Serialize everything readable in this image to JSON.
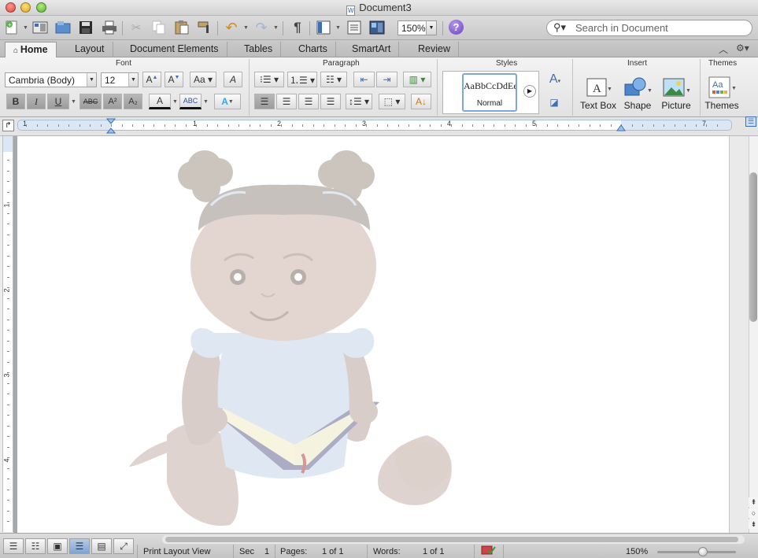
{
  "window": {
    "title": "Document3"
  },
  "toolbar": {
    "zoom": "150%",
    "search_placeholder": "Search in Document"
  },
  "tabs": [
    "Home",
    "Layout",
    "Document Elements",
    "Tables",
    "Charts",
    "SmartArt",
    "Review"
  ],
  "ribbon": {
    "group_labels": {
      "font": "Font",
      "paragraph": "Paragraph",
      "styles": "Styles",
      "insert": "Insert",
      "themes": "Themes"
    },
    "font_name": "Cambria (Body)",
    "font_size": "12",
    "style_preview": "AaBbCcDdEe",
    "style_name": "Normal",
    "insert_items": [
      "Text Box",
      "Shape",
      "Picture"
    ],
    "themes_label": "Themes",
    "font_buttons": {
      "bold": "B",
      "italic": "I",
      "underline": "U",
      "strike": "ABC",
      "superscript": "A²",
      "subscript": "A₂",
      "font_color": "A",
      "highlight": "ABC",
      "text_effects": "A"
    }
  },
  "ruler": {
    "h_numbers": [
      "1",
      "1",
      "2",
      "3",
      "4",
      "5",
      "7"
    ],
    "v_numbers": [
      "1",
      "2",
      "3",
      "4"
    ]
  },
  "status": {
    "view": "Print Layout View",
    "sec_label": "Sec",
    "sec_value": "1",
    "pages_label": "Pages:",
    "pages_value": "1 of 1",
    "words_label": "Words:",
    "words_value": "1 of 1",
    "zoom": "150%"
  },
  "colors": {
    "accent": "#4a7fc1",
    "help": "#6b3fc4"
  }
}
